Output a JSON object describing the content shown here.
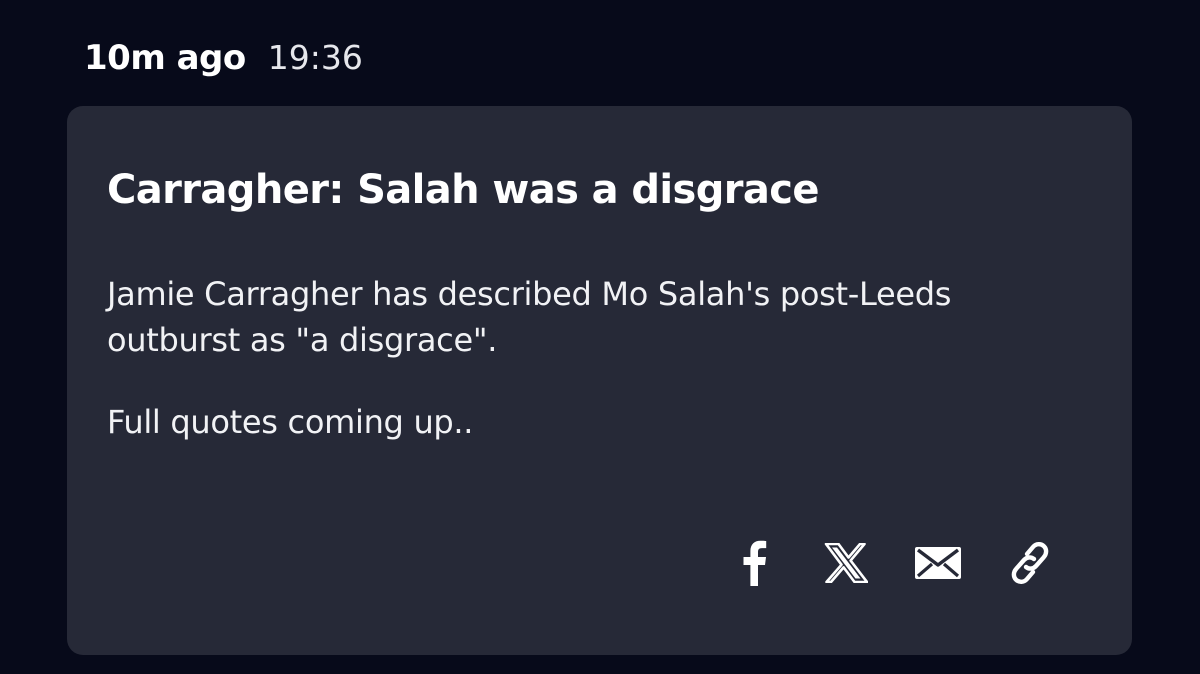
{
  "post": {
    "time_relative": "10m ago",
    "time_clock": "19:36",
    "headline": "Carragher: Salah was a disgrace",
    "paragraphs": [
      "Jamie Carragher has described Mo Salah's post-Leeds outburst as \"a disgrace\".",
      "Full quotes coming up.."
    ]
  },
  "share": {
    "icons": [
      "facebook-icon",
      "x-icon",
      "email-icon",
      "link-icon"
    ]
  },
  "colors": {
    "background": "#070a1a",
    "card": "#262937",
    "text": "#ffffff"
  }
}
